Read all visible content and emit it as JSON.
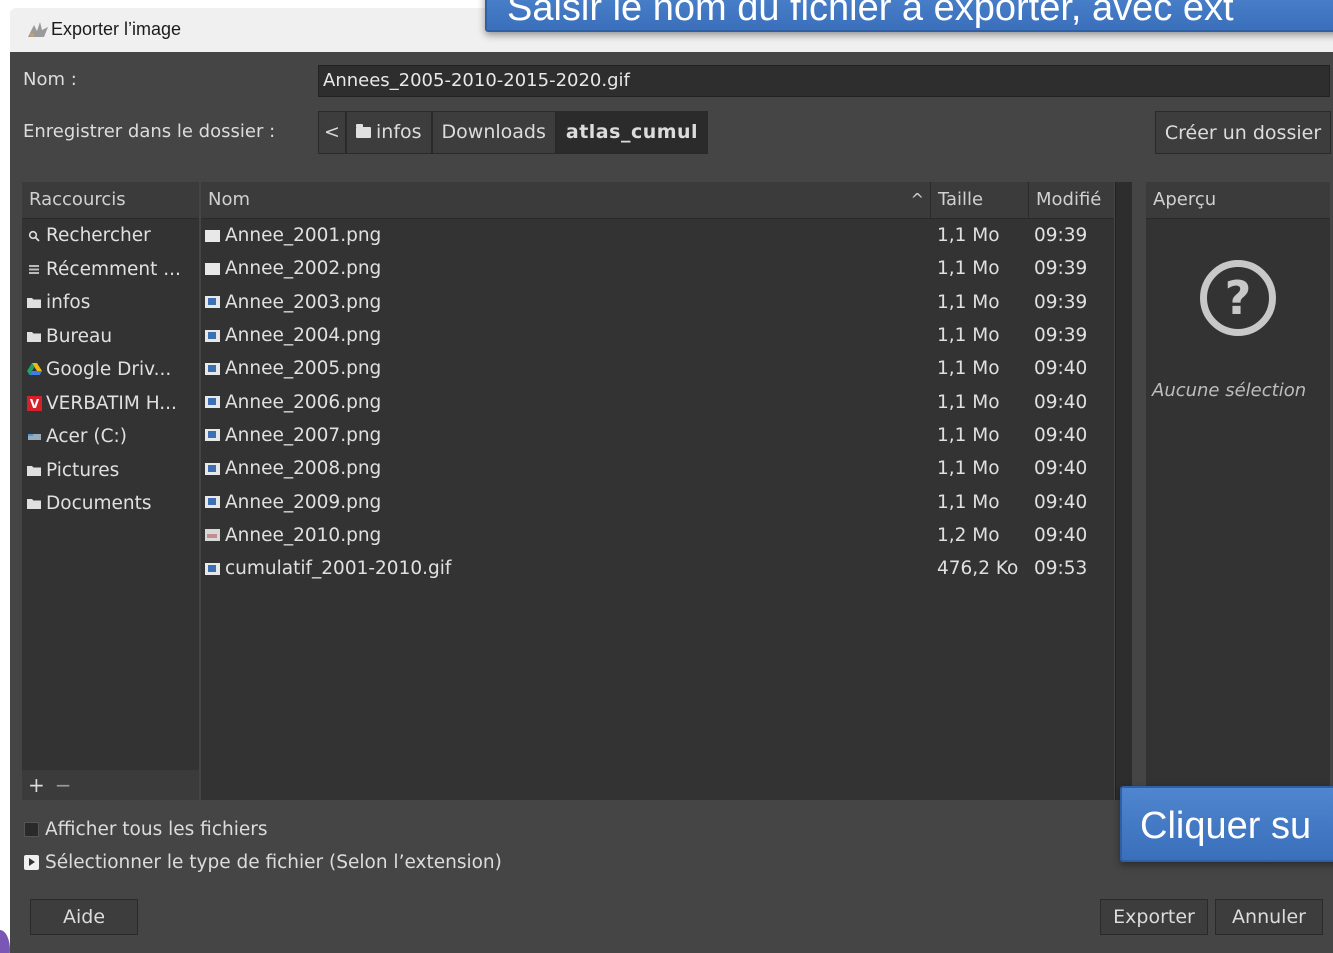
{
  "window": {
    "title": "Exporter l’image",
    "app_icon": "gimp-wilber-icon"
  },
  "callouts": {
    "top": "Saisir le nom du fichier à exporter, avec ext",
    "bottom": "Cliquer su"
  },
  "form": {
    "name_label": "Nom :",
    "name_value": "Annees_2005-2010-2015-2020.gif",
    "folder_label": "Enregistrer dans le dossier :",
    "breadcrumb_back": "<",
    "breadcrumb": [
      "infos",
      "Downloads",
      "atlas_cumul"
    ],
    "create_folder": "Créer un dossier"
  },
  "places": {
    "header": "Raccourcis",
    "items": [
      {
        "icon": "search-icon",
        "label": "Rechercher"
      },
      {
        "icon": "recent-icon",
        "label": "Récemment ..."
      },
      {
        "icon": "folder-icon",
        "label": "infos"
      },
      {
        "icon": "folder-icon",
        "label": "Bureau"
      },
      {
        "icon": "google-drive-icon",
        "label": "Google Driv..."
      },
      {
        "icon": "verbatim-icon",
        "label": "VERBATIM H..."
      },
      {
        "icon": "drive-icon",
        "label": "Acer (C:)"
      },
      {
        "icon": "folder-icon",
        "label": "Pictures"
      },
      {
        "icon": "folder-icon",
        "label": "Documents"
      }
    ],
    "add": "+",
    "remove": "−"
  },
  "files": {
    "columns": {
      "name": "Nom",
      "size": "Taille",
      "modified": "Modifié"
    },
    "rows": [
      {
        "icon": "plain",
        "name": "Annee_2001.png",
        "size": "1,1 Mo",
        "modified": "09:39"
      },
      {
        "icon": "plain",
        "name": "Annee_2002.png",
        "size": "1,1 Mo",
        "modified": "09:39"
      },
      {
        "icon": "img",
        "name": "Annee_2003.png",
        "size": "1,1 Mo",
        "modified": "09:39"
      },
      {
        "icon": "img",
        "name": "Annee_2004.png",
        "size": "1,1 Mo",
        "modified": "09:39"
      },
      {
        "icon": "img",
        "name": "Annee_2005.png",
        "size": "1,1 Mo",
        "modified": "09:40"
      },
      {
        "icon": "img",
        "name": "Annee_2006.png",
        "size": "1,1 Mo",
        "modified": "09:40"
      },
      {
        "icon": "img",
        "name": "Annee_2007.png",
        "size": "1,1 Mo",
        "modified": "09:40"
      },
      {
        "icon": "img",
        "name": "Annee_2008.png",
        "size": "1,1 Mo",
        "modified": "09:40"
      },
      {
        "icon": "img",
        "name": "Annee_2009.png",
        "size": "1,1 Mo",
        "modified": "09:40"
      },
      {
        "icon": "pic",
        "name": "Annee_2010.png",
        "size": "1,2 Mo",
        "modified": "09:40"
      },
      {
        "icon": "img",
        "name": "cumulatif_2001-2010.gif",
        "size": "476,2 Ko",
        "modified": "09:53"
      }
    ]
  },
  "preview": {
    "header": "Aperçu",
    "empty": "Aucune sélection"
  },
  "options": {
    "show_all": "Afficher tous les fichiers",
    "file_type": "Sélectionner le type de fichier (Selon l’extension)"
  },
  "buttons": {
    "help": "Aide",
    "export": "Exporter",
    "cancel": "Annuler"
  },
  "colors": {
    "window_bg": "#454545",
    "panel_bg": "#333333",
    "callout_blue": "#3a6fbb"
  }
}
